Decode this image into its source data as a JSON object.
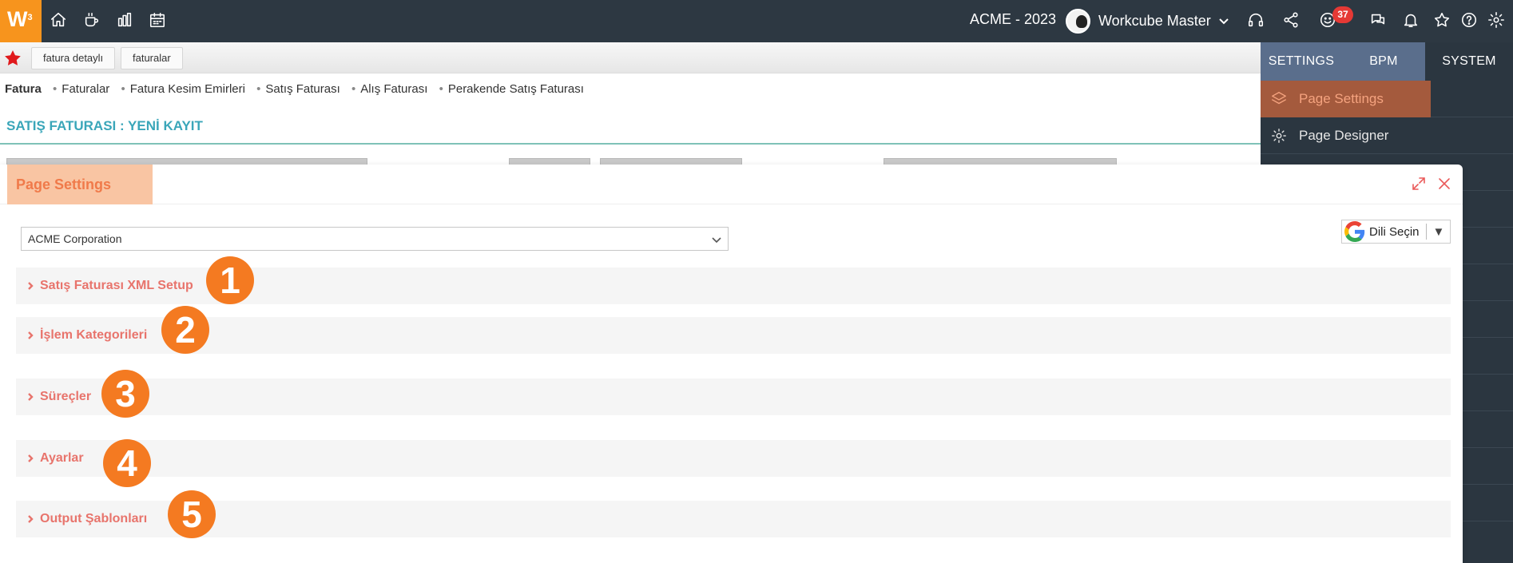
{
  "topbar": {
    "logo": "W",
    "logo_sup": "3",
    "company": "ACME - 2023",
    "user_name": "Workcube Master",
    "notification_count": "37",
    "icons": [
      "home-icon",
      "coffee-icon",
      "chart-icon",
      "calendar-icon",
      "headset-icon",
      "share-icon",
      "smiley-icon",
      "chat-icon",
      "bell-icon",
      "star-icon",
      "help-icon",
      "gear-icon"
    ]
  },
  "subbar": {
    "tabs": [
      "fatura detaylı",
      "faturalar"
    ]
  },
  "breadcrumb": {
    "items": [
      "Fatura",
      "Faturalar",
      "Fatura Kesim Emirleri",
      "Satış Faturası",
      "Alış Faturası",
      "Perakende Satış Faturası"
    ]
  },
  "page": {
    "title": "SATIŞ FATURASI : YENİ KAYIT"
  },
  "right_menu": {
    "tabs": [
      "SETTINGS",
      "BPM",
      "SYSTEM"
    ],
    "active_tab": "BPM",
    "items": [
      "Page Settings",
      "Page Designer"
    ],
    "active_item": "Page Settings"
  },
  "modal": {
    "title": "Page Settings",
    "company_select": {
      "value": "ACME Corporation"
    },
    "language_button": "Dili Seçin",
    "sections": [
      {
        "label": "Satış Faturası XML Setup",
        "step": "1"
      },
      {
        "label": "İşlem Kategorileri",
        "step": "2"
      },
      {
        "label": "Süreçler",
        "step": "3"
      },
      {
        "label": "Ayarlar",
        "step": "4"
      },
      {
        "label": "Output Şablonları",
        "step": "5"
      }
    ]
  },
  "colors": {
    "topbar_bg": "#2d3842",
    "logo_bg": "#f7941d",
    "accent_orange": "#f47a21",
    "section_text": "#e8746c",
    "page_title": "#3aa6b9"
  }
}
